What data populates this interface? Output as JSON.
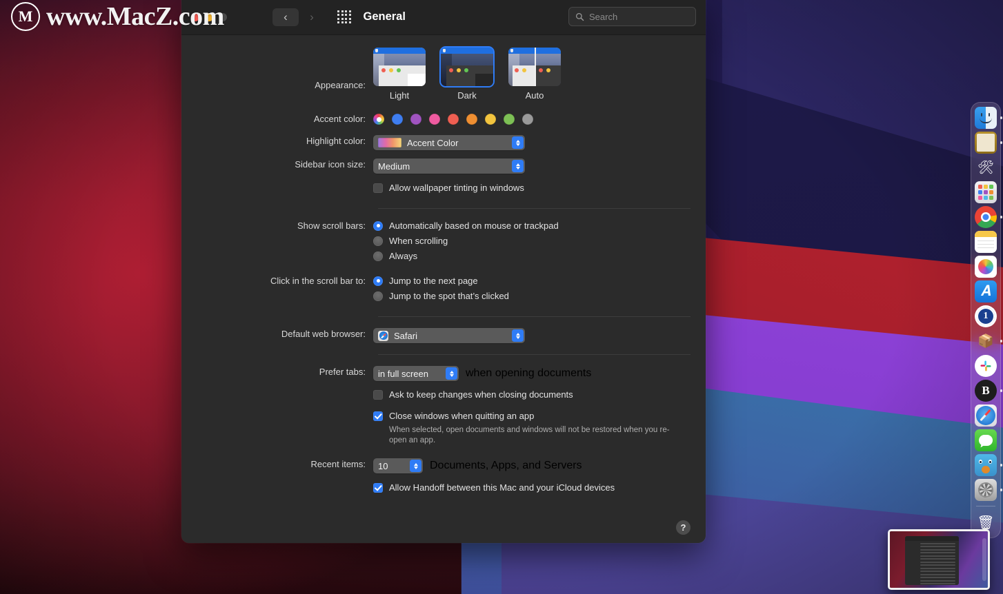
{
  "watermark": {
    "mark": "M",
    "text": "www.MacZ.com"
  },
  "window": {
    "title": "General",
    "back_glyph": "‹",
    "forward_glyph": "›",
    "grid_icon_name": "show-all-preferences-icon"
  },
  "search": {
    "placeholder": "Search",
    "value": ""
  },
  "appearance": {
    "label": "Appearance:",
    "options": [
      {
        "label": "Light",
        "selected": false
      },
      {
        "label": "Dark",
        "selected": true
      },
      {
        "label": "Auto",
        "selected": false
      }
    ]
  },
  "accent_color": {
    "label": "Accent color:",
    "selected": "multicolor",
    "swatches": [
      {
        "name": "multicolor",
        "hex": "multi"
      },
      {
        "name": "blue",
        "hex": "#3f7ef0"
      },
      {
        "name": "purple",
        "hex": "#a054c0"
      },
      {
        "name": "pink",
        "hex": "#ef5ba0"
      },
      {
        "name": "red",
        "hex": "#ef5f52"
      },
      {
        "name": "orange",
        "hex": "#ef8f32"
      },
      {
        "name": "yellow",
        "hex": "#f2c43f"
      },
      {
        "name": "green",
        "hex": "#7dc055"
      },
      {
        "name": "graphite",
        "hex": "#9a9a9a"
      }
    ]
  },
  "highlight_color": {
    "label": "Highlight color:",
    "value": "Accent Color"
  },
  "sidebar_icon_size": {
    "label": "Sidebar icon size:",
    "value": "Medium"
  },
  "wallpaper_tinting": {
    "label": "Allow wallpaper tinting in windows",
    "checked": false
  },
  "show_scroll_bars": {
    "label": "Show scroll bars:",
    "options": [
      {
        "label": "Automatically based on mouse or trackpad",
        "selected": true
      },
      {
        "label": "When scrolling",
        "selected": false
      },
      {
        "label": "Always",
        "selected": false
      }
    ]
  },
  "click_scroll_bar": {
    "label": "Click in the scroll bar to:",
    "options": [
      {
        "label": "Jump to the next page",
        "selected": true
      },
      {
        "label": "Jump to the spot that’s clicked",
        "selected": false
      }
    ]
  },
  "default_browser": {
    "label": "Default web browser:",
    "value": "Safari"
  },
  "prefer_tabs": {
    "label": "Prefer tabs:",
    "value": "in full screen",
    "suffix": "when opening documents"
  },
  "ask_keep_changes": {
    "label": "Ask to keep changes when closing documents",
    "checked": false
  },
  "close_windows": {
    "label": "Close windows when quitting an app",
    "checked": true,
    "note": "When selected, open documents and windows will not be restored when you re-open an app."
  },
  "recent_items": {
    "label": "Recent items:",
    "value": "10",
    "suffix": "Documents, Apps, and Servers"
  },
  "handoff": {
    "label": "Allow Handoff between this Mac and your iCloud devices",
    "checked": true
  },
  "help_button": {
    "glyph": "?"
  },
  "dock": {
    "items": [
      {
        "name": "finder",
        "running": true
      },
      {
        "name": "files",
        "running": true
      },
      {
        "name": "tools",
        "running": false,
        "glyph": "🛠"
      },
      {
        "name": "launchpad",
        "running": false
      },
      {
        "name": "chrome",
        "running": true
      },
      {
        "name": "notes",
        "running": false
      },
      {
        "name": "photos",
        "running": false
      },
      {
        "name": "app-store",
        "running": false
      },
      {
        "name": "1password",
        "running": false,
        "glyph": "1"
      },
      {
        "name": "unarchiver",
        "running": true,
        "glyph": "📦"
      },
      {
        "name": "slack",
        "running": false,
        "glyph": "✳"
      },
      {
        "name": "bear",
        "running": true,
        "glyph": "B"
      },
      {
        "name": "safari",
        "running": false
      },
      {
        "name": "messages",
        "running": false
      },
      {
        "name": "tweetbot",
        "running": true
      },
      {
        "name": "cleaner",
        "running": true
      },
      {
        "name": "trash",
        "running": false,
        "glyph": "🗑"
      }
    ]
  }
}
